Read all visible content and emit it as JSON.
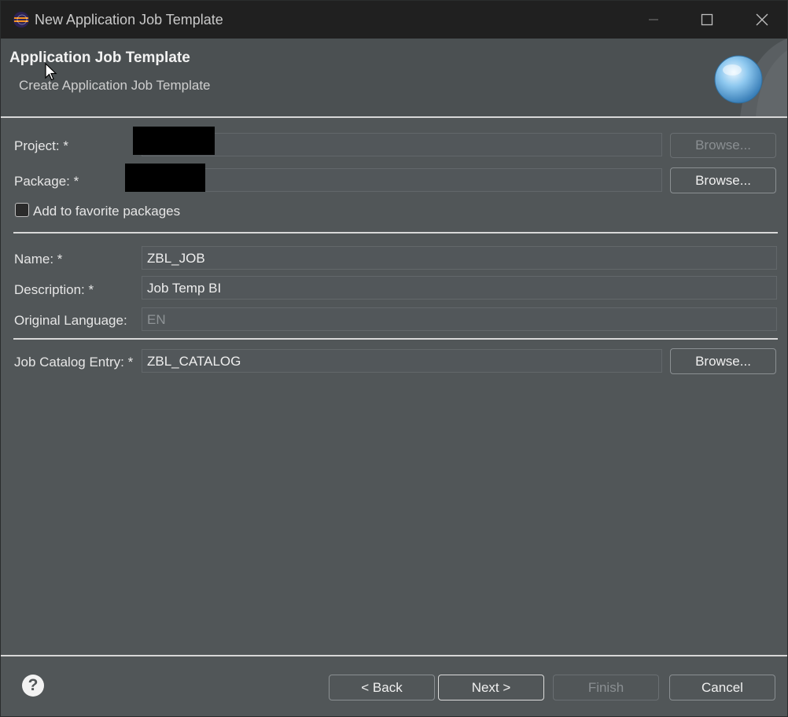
{
  "window": {
    "title": "New Application Job Template",
    "controls": {
      "minimize_icon": "minimize-icon",
      "maximize_icon": "maximize-icon",
      "close_icon": "close-icon"
    }
  },
  "header": {
    "title": "Application Job Template",
    "subtitle": "Create Application Job Template"
  },
  "form": {
    "project": {
      "label": "Project: *",
      "value": "",
      "browse": "Browse..."
    },
    "package": {
      "label": "Package: *",
      "value": "",
      "browse": "Browse..."
    },
    "favorite": {
      "label": "Add to favorite packages",
      "checked": false
    },
    "name": {
      "label": "Name: *",
      "value": "ZBL_JOB"
    },
    "description": {
      "label": "Description: *",
      "value": "Job Temp BI"
    },
    "original_language": {
      "label": "Original Language:",
      "value": "EN"
    },
    "job_catalog": {
      "label": "Job Catalog Entry: *",
      "value": "ZBL_CATALOG",
      "browse": "Browse..."
    }
  },
  "footer": {
    "back": "< Back",
    "next": "Next >",
    "finish": "Finish",
    "cancel": "Cancel"
  },
  "colors": {
    "background": "#515658",
    "titlebar": "#202020",
    "separator": "#d8d8d8"
  }
}
